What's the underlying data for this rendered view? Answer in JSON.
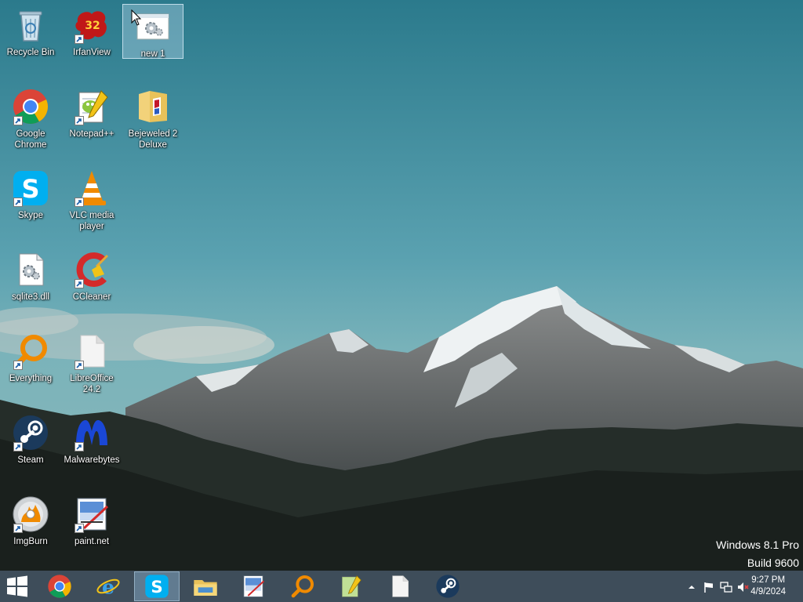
{
  "desktop": {
    "icons": [
      {
        "label": "Recycle Bin",
        "icon": "recycle-bin-icon"
      },
      {
        "label": "IrfanView",
        "icon": "irfanview-icon",
        "badge": "32"
      },
      {
        "label": "new 1",
        "icon": "settings-file-icon"
      },
      {
        "label": "Google Chrome",
        "icon": "chrome-icon"
      },
      {
        "label": "Notepad++",
        "icon": "notepadpp-icon"
      },
      {
        "label": "Bejeweled 2 Deluxe",
        "icon": "folder-icon"
      },
      {
        "label": "Skype",
        "icon": "skype-icon"
      },
      {
        "label": "VLC media player",
        "icon": "vlc-icon"
      },
      {
        "label": "sqlite3.dll",
        "icon": "dll-file-icon"
      },
      {
        "label": "CCleaner",
        "icon": "ccleaner-icon"
      },
      {
        "label": "Everything",
        "icon": "everything-search-icon"
      },
      {
        "label": "LibreOffice 24.2",
        "icon": "libreoffice-icon"
      },
      {
        "label": "Steam",
        "icon": "steam-icon"
      },
      {
        "label": "Malwarebytes",
        "icon": "malwarebytes-icon"
      },
      {
        "label": "ImgBurn",
        "icon": "imgburn-icon"
      },
      {
        "label": "paint.net",
        "icon": "paintnet-icon"
      }
    ],
    "selected": "new 1"
  },
  "watermark": {
    "line1": "Windows 8.1 Pro",
    "line2": "Build 9600"
  },
  "taskbar": {
    "buttons": [
      {
        "name": "start",
        "icon": "windows-logo-icon"
      },
      {
        "name": "chrome",
        "icon": "chrome-icon"
      },
      {
        "name": "internet-explorer",
        "icon": "ie-icon"
      },
      {
        "name": "skype",
        "icon": "skype-icon",
        "active": true
      },
      {
        "name": "file-explorer",
        "icon": "folder-icon"
      },
      {
        "name": "paint-net",
        "icon": "paintnet-icon"
      },
      {
        "name": "everything",
        "icon": "everything-search-icon"
      },
      {
        "name": "notepadpp",
        "icon": "notepadpp-icon"
      },
      {
        "name": "libreoffice",
        "icon": "libreoffice-icon"
      },
      {
        "name": "steam",
        "icon": "steam-icon"
      }
    ],
    "tray": {
      "icons": [
        "chevron-up-icon",
        "flag-icon",
        "network-icon",
        "volume-muted-icon"
      ],
      "time": "9:27 PM",
      "date": "4/9/2024"
    }
  },
  "colors": {
    "taskbar": "#3e4d5a",
    "selection": "#c8e1f5",
    "skype": "#00aff0",
    "vlc": "#f08a00",
    "steam": "#1b2838",
    "malwarebytes": "#0b3cc9"
  }
}
